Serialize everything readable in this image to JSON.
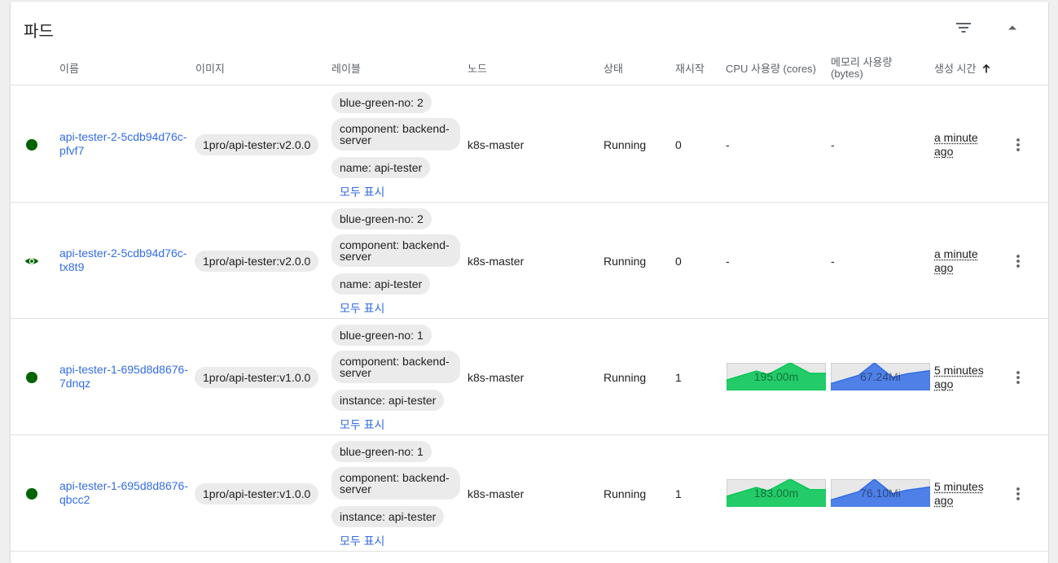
{
  "card": {
    "title": "파드"
  },
  "columns": {
    "name": "이름",
    "image": "이미지",
    "labels": "레이블",
    "node": "노드",
    "status": "상태",
    "restarts": "재시작",
    "cpu": "CPU 사용량 (cores)",
    "memory_line1": "메모리 사용량",
    "memory_line2": "(bytes)",
    "created": "생성 시간"
  },
  "show_all_label": "모두 표시",
  "colors": {
    "link": "#326de6",
    "ok": "#006400",
    "cpu": "#00c752",
    "memory": "#326de6"
  },
  "rows": [
    {
      "status_icon": "running-dot-icon",
      "name_line1": "api-tester-2-5cdb94d76c-",
      "name_line2": "pfvf7",
      "image": "1pro/api-tester:v2.0.0",
      "labels": [
        "blue-green-no: 2",
        "component: backend-server",
        "name: api-tester"
      ],
      "node": "k8s-master",
      "status": "Running",
      "restarts": "0",
      "cpu": "-",
      "memory": "-",
      "age_line1": "a minute",
      "age_line2": "ago"
    },
    {
      "status_icon": "eye-icon",
      "name_line1": "api-tester-2-5cdb94d76c-",
      "name_line2": "tx8t9",
      "image": "1pro/api-tester:v2.0.0",
      "labels": [
        "blue-green-no: 2",
        "component: backend-server",
        "name: api-tester"
      ],
      "node": "k8s-master",
      "status": "Running",
      "restarts": "0",
      "cpu": "-",
      "memory": "-",
      "age_line1": "a minute",
      "age_line2": "ago"
    },
    {
      "status_icon": "running-dot-icon",
      "name_line1": "api-tester-1-695d8d8676-",
      "name_line2": "7dnqz",
      "image": "1pro/api-tester:v1.0.0",
      "labels": [
        "blue-green-no: 1",
        "component: backend-server",
        "instance: api-tester"
      ],
      "node": "k8s-master",
      "status": "Running",
      "restarts": "1",
      "cpu": "195.00m",
      "memory": "67.24Mi",
      "age_line1": "5 minutes",
      "age_line2": "ago"
    },
    {
      "status_icon": "running-dot-icon",
      "name_line1": "api-tester-1-695d8d8676-",
      "name_line2": "qbcc2",
      "image": "1pro/api-tester:v1.0.0",
      "labels": [
        "blue-green-no: 1",
        "component: backend-server",
        "instance: api-tester"
      ],
      "node": "k8s-master",
      "status": "Running",
      "restarts": "1",
      "cpu": "183.00m",
      "memory": "76.10Mi",
      "age_line1": "5 minutes",
      "age_line2": "ago"
    }
  ]
}
